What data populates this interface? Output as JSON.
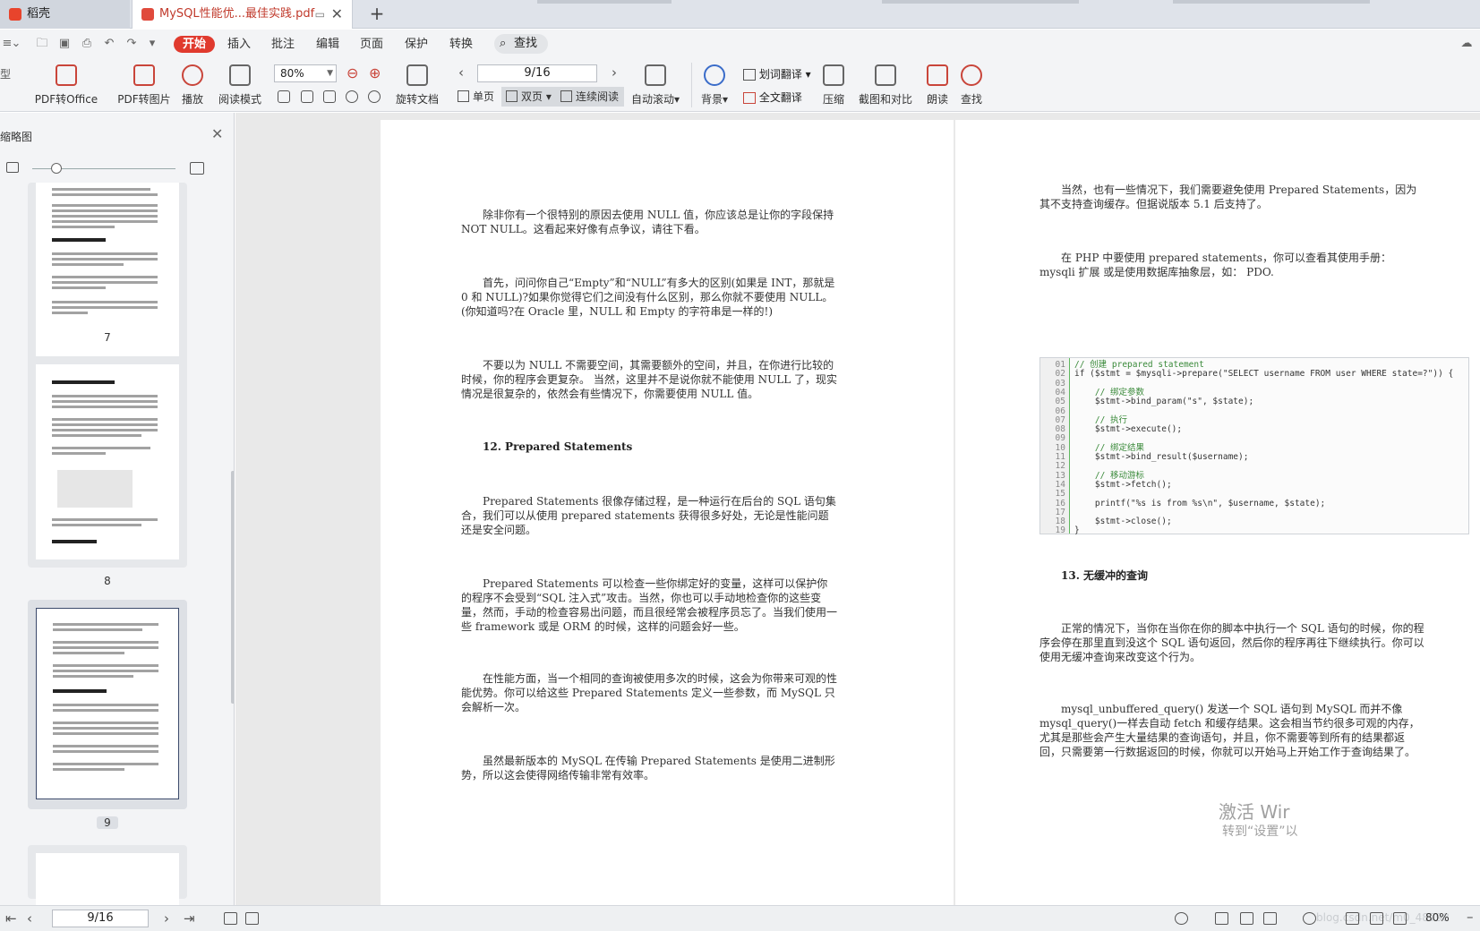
{
  "tabs": {
    "home_label": "稻壳",
    "pdf_label": "MySQL性能优...最佳实践.pdf"
  },
  "menu": {
    "start": "开始",
    "insert": "插入",
    "annotate": "批注",
    "edit": "编辑",
    "page": "页面",
    "protect": "保护",
    "convert": "转换",
    "find": "查找"
  },
  "toolbar": {
    "pdf_to_office": "PDF转Office",
    "pdf_to_image": "PDF转图片",
    "play": "播放",
    "read_mode": "阅读模式",
    "zoom_value": "80%",
    "rotate": "旋转文档",
    "page_value": "9/16",
    "single": "单页",
    "double": "双页",
    "continuous": "连续阅读",
    "auto_scroll": "自动滚动",
    "background": "背景",
    "word_translate": "划词翻译",
    "full_translate": "全文翻译",
    "compress": "压缩",
    "screenshot_compare": "截图和对比",
    "read_aloud": "朗读",
    "search": "查找"
  },
  "sidebar": {
    "title": "缩略图",
    "thumbs": [
      "7",
      "8",
      "9"
    ]
  },
  "left_page": {
    "p1": "除非你有一个很特别的原因去使用 NULL 值，你应该总是让你的字段保持 NOT NULL。这看起来好像有点争议，请往下看。",
    "p2": "首先，问问你自己“Empty”和“NULL”有多大的区别(如果是 INT，那就是 0 和 NULL)?如果你觉得它们之间没有什么区别，那么你就不要使用 NULL。(你知道吗?在 Oracle 里，NULL 和 Empty 的字符串是一样的!)",
    "p3": "不要以为 NULL 不需要空间，其需要额外的空间，并且，在你进行比较的时候，你的程序会更复杂。 当然，这里并不是说你就不能使用 NULL 了，现实情况是很复杂的，依然会有些情况下，你需要使用 NULL 值。",
    "h12": "12. Prepared Statements",
    "p4": "Prepared Statements 很像存储过程，是一种运行在后台的 SQL 语句集合，我们可以从使用 prepared statements 获得很多好处，无论是性能问题还是安全问题。",
    "p5": "Prepared Statements 可以检查一些你绑定好的变量，这样可以保护你的程序不会受到“SQL 注入式”攻击。当然，你也可以手动地检查你的这些变量，然而，手动的检查容易出问题，而且很经常会被程序员忘了。当我们使用一些 framework 或是 ORM 的时候，这样的问题会好一些。",
    "p6": "在性能方面，当一个相同的查询被使用多次的时候，这会为你带来可观的性能优势。你可以给这些 Prepared Statements 定义一些参数，而 MySQL 只会解析一次。",
    "p7": "虽然最新版本的 MySQL 在传输 Prepared Statements 是使用二进制形势，所以这会使得网络传输非常有效率。"
  },
  "right_page": {
    "p1": "当然，也有一些情况下，我们需要避免使用 Prepared Statements，因为其不支持查询缓存。但据说版本 5.1 后支持了。",
    "p2": "在 PHP 中要使用 prepared statements，你可以查看其使用手册：mysqli 扩展 或是使用数据库抽象层，如： PDO.",
    "code": [
      {
        "n": "01",
        "t": "// 创建 prepared statement"
      },
      {
        "n": "02",
        "t": "if ($stmt = $mysqli->prepare(\"SELECT username FROM user WHERE state=?\")) {"
      },
      {
        "n": "03",
        "t": ""
      },
      {
        "n": "04",
        "t": "    // 绑定参数"
      },
      {
        "n": "05",
        "t": "    $stmt->bind_param(\"s\", $state);"
      },
      {
        "n": "06",
        "t": ""
      },
      {
        "n": "07",
        "t": "    // 执行"
      },
      {
        "n": "08",
        "t": "    $stmt->execute();"
      },
      {
        "n": "09",
        "t": ""
      },
      {
        "n": "10",
        "t": "    // 绑定结果"
      },
      {
        "n": "11",
        "t": "    $stmt->bind_result($username);"
      },
      {
        "n": "12",
        "t": ""
      },
      {
        "n": "13",
        "t": "    // 移动游标"
      },
      {
        "n": "14",
        "t": "    $stmt->fetch();"
      },
      {
        "n": "15",
        "t": ""
      },
      {
        "n": "16",
        "t": "    printf(\"%s is from %s\\n\", $username, $state);"
      },
      {
        "n": "17",
        "t": ""
      },
      {
        "n": "18",
        "t": "    $stmt->close();"
      },
      {
        "n": "19",
        "t": "}"
      }
    ],
    "h13": "13. 无缓冲的查询",
    "p3": "正常的情况下，当你在当你在你的脚本中执行一个 SQL 语句的时候，你的程序会停在那里直到没这个 SQL 语句返回，然后你的程序再往下继续执行。你可以使用无缓冲查询来改变这个行为。",
    "p4": "mysql_unbuffered_query() 发送一个 SQL 语句到 MySQL 而并不像 mysql_query()一样去自动 fetch 和缓存结果。这会相当节约很多可观的内存，尤其是那些会产生大量结果的查询语句，并且，你不需要等到所有的结果都返回，只需要第一行数据返回的时候，你就可以开始马上开始工作于查询结果了。"
  },
  "watermark": {
    "line1": "激活 Wir",
    "line2": "转到“设置”以"
  },
  "statusbar": {
    "page_value": "9/16",
    "zoom": "80%",
    "ghost": "blog.csdn.net/m0_48798"
  }
}
